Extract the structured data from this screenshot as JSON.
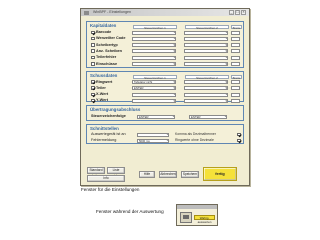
{
  "window": {
    "title": "WinBPF - Einstellungen",
    "min_glyph": "_",
    "max_glyph": "□",
    "close_glyph": "×"
  },
  "kapitaldaten": {
    "title": "Kapitaldaten",
    "col1": "Steuerzeichen 1",
    "col2": "Steuerzeichen 2",
    "col3": "Breite",
    "rows": [
      {
        "label": "Barcode",
        "checked": true,
        "field1": "",
        "field2": ""
      },
      {
        "label": "Wenzeilter Code",
        "checked": false,
        "field1": "",
        "field2": ""
      },
      {
        "label": "Scheibertyp",
        "checked": false,
        "field1": "",
        "field2": ""
      },
      {
        "label": "Anz. Scheiben",
        "checked": false,
        "field1": "",
        "field2": ""
      },
      {
        "label": "Teilerfehler",
        "checked": false,
        "field1": "",
        "field2": ""
      },
      {
        "label": "Einschüsse",
        "checked": false,
        "field1": "",
        "field2": ""
      }
    ]
  },
  "schussdaten": {
    "title": "Schussdaten",
    "col1": "Steuerzeichen 1",
    "col2": "Steuerzeichen 2",
    "col3": "Breite",
    "rows": [
      {
        "label": "Ringwert",
        "checked": true,
        "field1": "Tabulator nicht",
        "field2": ""
      },
      {
        "label": "Teiler",
        "checked": true,
        "field1": "ENTER",
        "field2": ""
      },
      {
        "label": "X-Wert",
        "checked": true,
        "field1": "",
        "field2": ""
      },
      {
        "label": "Y-Wert",
        "checked": true,
        "field1": "",
        "field2": ""
      }
    ]
  },
  "uebertragung": {
    "title": "Übertragungsabschluss",
    "label": "Steuerzeichenfolge",
    "field1": "ENTER",
    "field2": "ENTER"
  },
  "schnittstellen": {
    "title": "Schnittstellen",
    "r1_label": "Auswertegerät ist an",
    "r1_value": "",
    "r1_right": "Komma als Dezimaltrenner",
    "r2_label": "Fehlermeldung",
    "r2_value": "5000 ms",
    "r2_right": "Ringwerte ohne Dezimale"
  },
  "buttons": {
    "left1": "Standard laden",
    "left2": "Liste speichern",
    "left3": "Info",
    "mid1": "Hilfe",
    "mid2": "Abbrechen",
    "ok": "Speichern",
    "yellow": "fertig"
  },
  "captions": {
    "settings": "Fenster für die Einstellungen",
    "eval": "Fenster während der Auswertung"
  },
  "mini": {
    "button": "Wahrg. auswerten"
  },
  "colors": {
    "window_bg": "#f1edd2",
    "section_border": "#5f86b3",
    "section_title": "#3566a1",
    "accent_yellow": "#f5e13a"
  }
}
